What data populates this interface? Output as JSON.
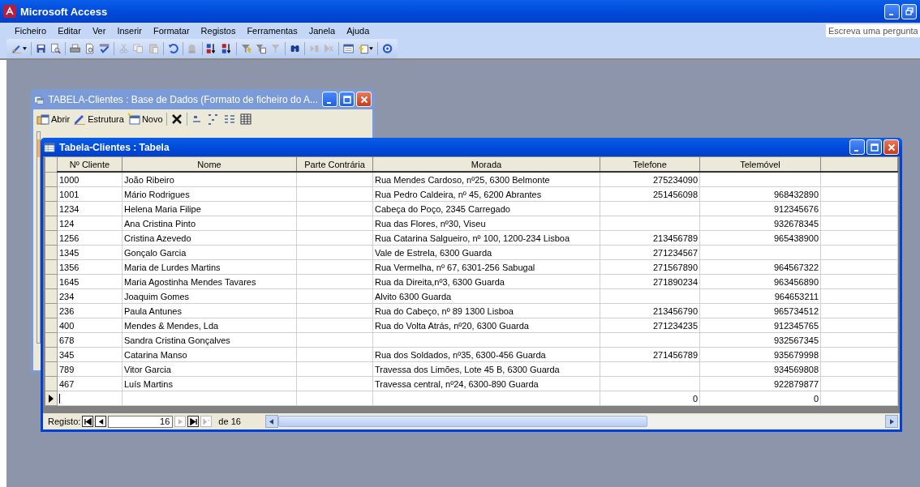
{
  "window": {
    "title": "Microsoft Access"
  },
  "menu": [
    {
      "label": "Ficheiro"
    },
    {
      "label": "Editar"
    },
    {
      "label": "Ver"
    },
    {
      "label": "Inserir"
    },
    {
      "label": "Formatar"
    },
    {
      "label": "Registos"
    },
    {
      "label": "Ferramentas"
    },
    {
      "label": "Janela"
    },
    {
      "label": "Ajuda"
    }
  ],
  "help_box": {
    "placeholder": "Escreva uma pergunta"
  },
  "database_window": {
    "title": "TABELA-Clientes : Base de Dados (Formato de ficheiro do A...",
    "toolbar": [
      {
        "label": "Abrir",
        "kind": "open"
      },
      {
        "label": "Estrutura",
        "kind": "design"
      },
      {
        "label": "Novo",
        "kind": "new"
      }
    ]
  },
  "table_window": {
    "title": "Tabela-Clientes : Tabela",
    "columns": [
      "Nº Cliente",
      "Nome",
      "Parte Contrária",
      "Morada",
      "Telefone",
      "Telemóvel"
    ],
    "rows": [
      {
        "cliente": "1000",
        "nome": "João Ribeiro",
        "morada": "Rua Mendes Cardoso, nº25, 6300 Belmonte",
        "telefone": "275234090"
      },
      {
        "cliente": "1001",
        "nome": "Mário Rodrigues",
        "morada": "Rua Pedro Caldeira, nº 45, 6200 Abrantes",
        "telefone": "251456098",
        "telemovel": "968432890"
      },
      {
        "cliente": "1234",
        "nome": "Helena Maria Filipe",
        "morada": "Cabeça do Poço, 2345 Carregado",
        "telemovel": "912345676"
      },
      {
        "cliente": "124",
        "nome": "Ana Cristina Pinto",
        "morada": "Rua das Flores, nº30, Viseu",
        "telemovel": "932678345"
      },
      {
        "cliente": "1256",
        "nome": "Cristina Azevedo",
        "morada": "Rua Catarina Salgueiro, nº 100, 1200-234 Lisboa",
        "telefone": "213456789",
        "telemovel": "965438900"
      },
      {
        "cliente": "1345",
        "nome": "Gonçalo Garcia",
        "morada": "Vale de Estrela, 6300 Guarda",
        "telefone": "271234567"
      },
      {
        "cliente": "1356",
        "nome": "Maria de Lurdes Martins",
        "morada": "Rua Vermelha, nº 67, 6301-256 Sabugal",
        "telefone": "271567890",
        "telemovel": "964567322"
      },
      {
        "cliente": "1645",
        "nome": "Maria Agostinha Mendes Tavares",
        "morada": "Rua da Direita,nº3, 6300 Guarda",
        "telefone": "271890234",
        "telemovel": "963456890"
      },
      {
        "cliente": "234",
        "nome": "Joaquim Gomes",
        "morada": "Alvito 6300 Guarda",
        "telemovel": "964653211"
      },
      {
        "cliente": "236",
        "nome": "Paula Antunes",
        "morada": "Rua do Cabeço, nº 89 1300 Lisboa",
        "telefone": "213456790",
        "telemovel": "965734512"
      },
      {
        "cliente": "400",
        "nome": "Mendes & Mendes, Lda",
        "morada": "Rua do Volta Atrás, nº20, 6300 Guarda",
        "telefone": "271234235",
        "telemovel": "912345765"
      },
      {
        "cliente": "678",
        "nome": "Sandra Cristina Gonçalves",
        "telemovel": "932567345"
      },
      {
        "cliente": "345",
        "nome": "Catarina Manso",
        "morada": "Rua dos Soldados, nº35, 6300-456 Guarda",
        "telefone": "271456789",
        "telemovel": "935679998"
      },
      {
        "cliente": "789",
        "nome": "Vitor Garcia",
        "morada": "Travessa dos Limões, Lote 45 B, 6300 Guarda",
        "telemovel": "934569808"
      },
      {
        "cliente": "467",
        "nome": "Luís Martins",
        "morada": "Travessa central, nº24, 6300-890 Guarda",
        "telemovel": "922879877"
      }
    ],
    "new_row": {
      "selected": true,
      "telefone": "0",
      "telemovel": "0"
    },
    "navigation": {
      "label": "Registo:",
      "current": "16",
      "total": "de 16"
    }
  }
}
